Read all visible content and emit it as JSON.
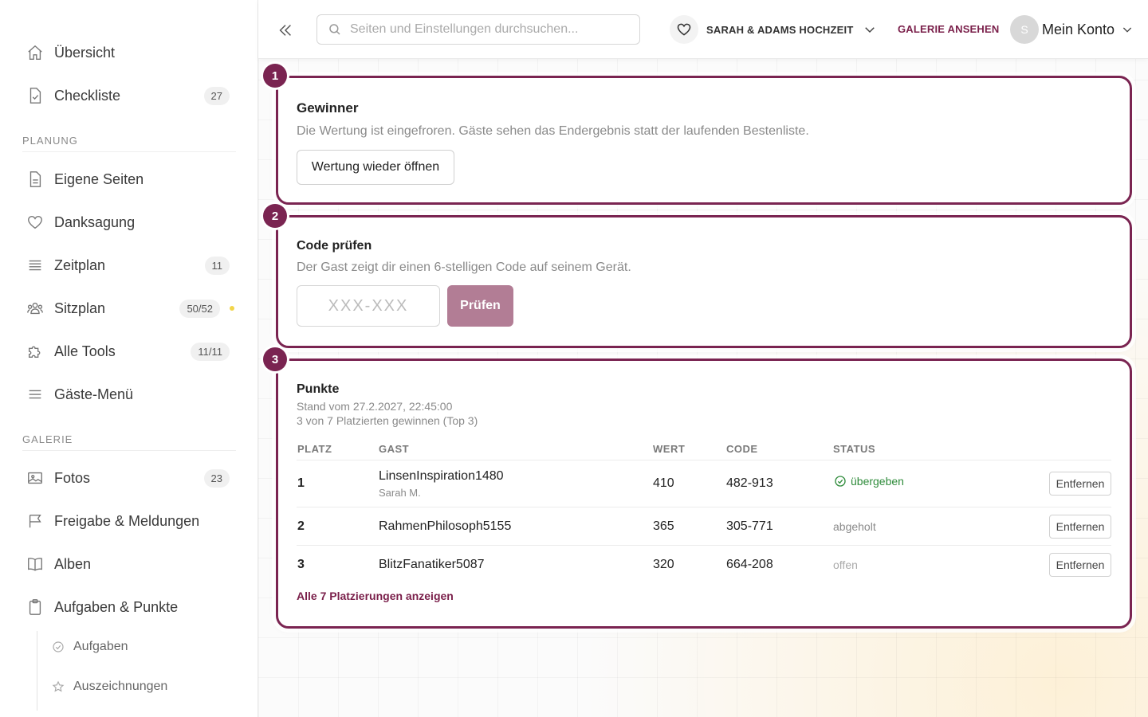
{
  "sidebar": {
    "items": [
      {
        "label": "Übersicht",
        "icon": "home-icon"
      },
      {
        "label": "Checkliste",
        "badge": "27",
        "icon": "checklist-icon"
      },
      {
        "label": "Eigene Seiten",
        "icon": "page-icon"
      },
      {
        "label": "Danksagung",
        "icon": "heart-icon"
      },
      {
        "label": "Zeitplan",
        "badge": "11",
        "icon": "list-icon"
      },
      {
        "label": "Sitzplan",
        "badge": "50/52",
        "icon": "guests-icon"
      },
      {
        "label": "Alle Tools",
        "badge": "11/11",
        "icon": "puzzle-icon"
      },
      {
        "label": "Gäste-Menü",
        "icon": "menu-icon"
      },
      {
        "label": "Fotos",
        "badge": "23",
        "icon": "image-icon"
      },
      {
        "label": "Freigabe & Meldungen",
        "icon": "flag-icon"
      },
      {
        "label": "Alben",
        "icon": "book-icon"
      },
      {
        "label": "Aufgaben & Punkte",
        "icon": "clipboard-icon"
      }
    ],
    "sections": {
      "planung": "PLANUNG",
      "galerie": "GALERIE"
    },
    "sub_items": [
      {
        "label": "Aufgaben",
        "icon": "check-circle-icon"
      },
      {
        "label": "Auszeichnungen",
        "icon": "star-icon"
      }
    ],
    "status_dot_color": "#f2d54a"
  },
  "topbar": {
    "search_placeholder": "Seiten und Einstellungen durchsuchen...",
    "event_name": "SARAH & ADAMS HOCHZEIT",
    "gallery_link": "GALERIE ANSEHEN",
    "avatar_initial": "S",
    "account_label": "Mein Konto"
  },
  "winner": {
    "step": "1",
    "title": "Gewinner",
    "desc": "Die Wertung ist eingefroren. Gäste sehen das Endergebnis statt der laufenden Bestenliste.",
    "button": "Wertung wieder öffnen"
  },
  "check": {
    "step": "2",
    "title": "Code prüfen",
    "desc": "Der Gast zeigt dir einen 6-stelligen Code auf seinem Gerät.",
    "placeholder": "XXX-XXX",
    "button": "Prüfen"
  },
  "points": {
    "step": "3",
    "title": "Punkte",
    "timestamp": "Stand vom 27.2.2027, 22:45:00",
    "summary": "3 von 7 Platzierten gewinnen (Top 3)",
    "headers": {
      "rank": "PLATZ",
      "guest": "GAST",
      "value": "WERT",
      "code": "CODE",
      "status": "STATUS"
    },
    "rows": [
      {
        "rank": "1",
        "guest": "LinsenInspiration1480",
        "guest_sub": "Sarah M.",
        "value": "410",
        "code": "482-913",
        "status": "übergeben",
        "action": "Entfernen"
      },
      {
        "rank": "2",
        "guest": "RahmenPhilosoph5155",
        "value": "365",
        "code": "305-771",
        "status": "abgeholt",
        "action": "Entfernen"
      },
      {
        "rank": "3",
        "guest": "BlitzFanatiker5087",
        "value": "320",
        "code": "664-208",
        "status": "offen",
        "action": "Entfernen"
      }
    ],
    "show_all": "Alle 7 Platzierungen anzeigen"
  },
  "colors": {
    "accent": "#7a2451",
    "button_check": "#b27d95",
    "status_ok": "#2e8b3a"
  }
}
